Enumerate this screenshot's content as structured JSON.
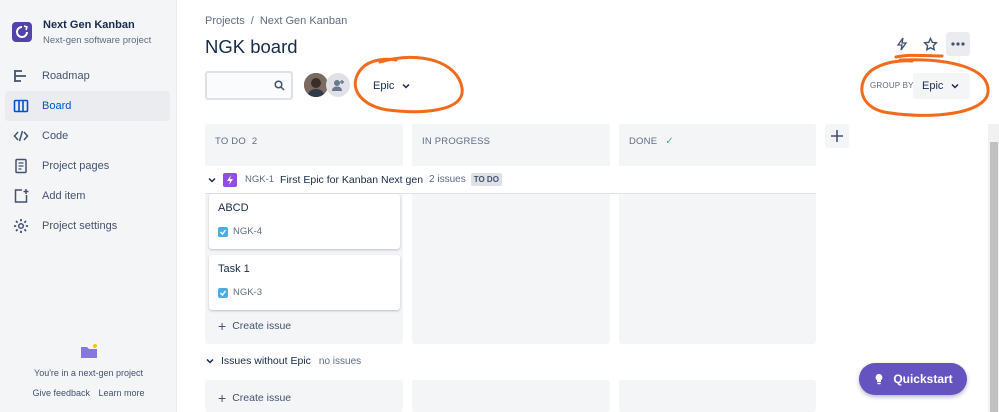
{
  "project": {
    "name": "Next Gen Kanban",
    "type": "Next-gen software project"
  },
  "sidebar": {
    "items": [
      {
        "label": "Roadmap",
        "icon": "roadmap-icon"
      },
      {
        "label": "Board",
        "icon": "board-icon",
        "active": true
      },
      {
        "label": "Code",
        "icon": "code-icon"
      },
      {
        "label": "Project pages",
        "icon": "page-icon"
      },
      {
        "label": "Add item",
        "icon": "add-item-icon"
      },
      {
        "label": "Project settings",
        "icon": "gear-icon"
      }
    ],
    "footer_note": "You're in a next-gen project",
    "give_feedback": "Give feedback",
    "learn_more": "Learn more"
  },
  "breadcrumb": {
    "projects": "Projects",
    "separator": "/",
    "project": "Next Gen Kanban"
  },
  "page_title": "NGK board",
  "toolbar": {
    "epic_filter": "Epic",
    "group_by_label": "GROUP BY",
    "group_by_value": "Epic"
  },
  "columns": [
    {
      "name": "TO DO",
      "count": "2"
    },
    {
      "name": "IN PROGRESS",
      "count": ""
    },
    {
      "name": "DONE",
      "count": "",
      "done_check": "✓"
    }
  ],
  "swimlane": {
    "key": "NGK-1",
    "title": "First Epic for Kanban Next gen",
    "issues": "2 issues",
    "status": "TO DO"
  },
  "cards": [
    {
      "title": "ABCD",
      "key": "NGK-4"
    },
    {
      "title": "Task 1",
      "key": "NGK-3"
    }
  ],
  "create_issue": "Create issue",
  "no_epic": {
    "title": "Issues without Epic",
    "count": "no issues"
  },
  "quickstart": "Quickstart",
  "colors": {
    "accent": "#0052cc",
    "annotation": "#f26a1b",
    "quickstart": "#6554c0",
    "epic": "#904ee2"
  }
}
